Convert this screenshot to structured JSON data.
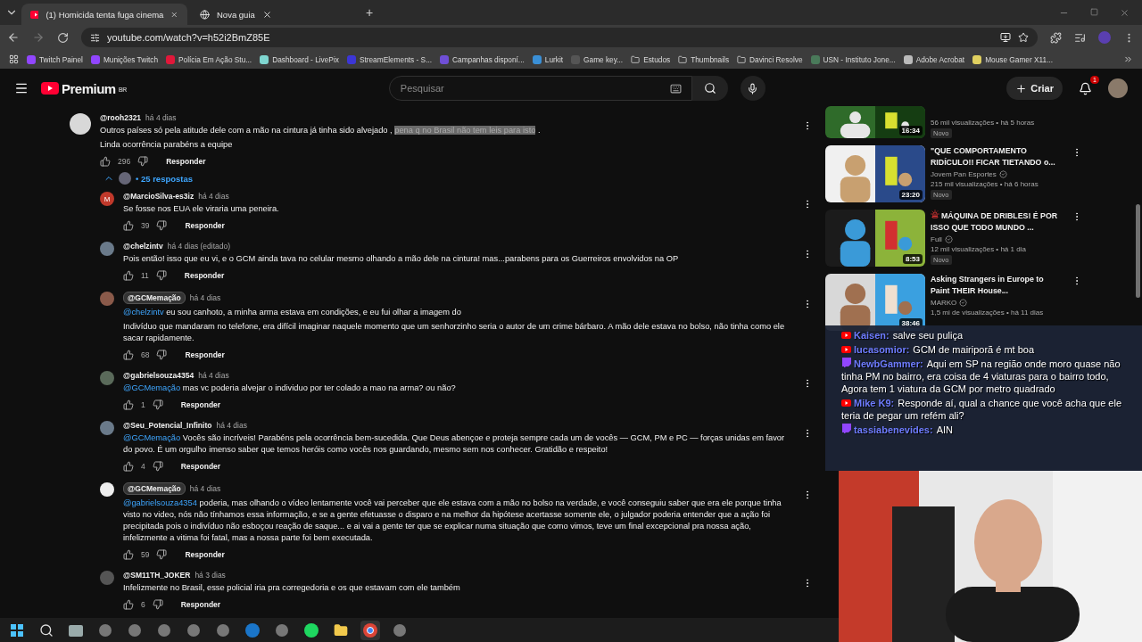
{
  "browser": {
    "tabs": [
      {
        "title": "(1) Homicida tenta fuga cinema",
        "selected": true,
        "kind": "youtube"
      },
      {
        "title": "Nova guia",
        "selected": false,
        "kind": "chrome"
      }
    ],
    "new_tab": "+",
    "url": "youtube.com/watch?v=h52i2BmZ85E",
    "bookmarks": [
      {
        "label": "Twitch Painel",
        "kind": "site",
        "color": "#9146ff"
      },
      {
        "label": "Munições Twitch",
        "kind": "site",
        "color": "#9146ff"
      },
      {
        "label": "Polícia Em Ação Stu...",
        "kind": "site",
        "color": "#e0183a"
      },
      {
        "label": "Dashboard - LivePix",
        "kind": "site",
        "color": "#7fd6d0"
      },
      {
        "label": "StreamElements - S...",
        "kind": "site",
        "color": "#3c36d6"
      },
      {
        "label": "Campanhas disponí...",
        "kind": "site",
        "color": "#6f4fd6"
      },
      {
        "label": "Lurkit",
        "kind": "site",
        "color": "#3a8fd6"
      },
      {
        "label": "Game key...",
        "kind": "site",
        "color": "#555555"
      },
      {
        "label": "Estudos",
        "kind": "folder"
      },
      {
        "label": "Thumbnails",
        "kind": "folder"
      },
      {
        "label": "Davinci Resolve",
        "kind": "folder"
      },
      {
        "label": "USN - Instituto Jone...",
        "kind": "site",
        "color": "#4a7a5a"
      },
      {
        "label": "Adobe Acrobat",
        "kind": "site",
        "color": "#bbbbbb"
      },
      {
        "label": "Mouse Gamer X11...",
        "kind": "site",
        "color": "#e0d060"
      }
    ]
  },
  "header": {
    "logo": "Premium",
    "region": "BR",
    "search": {
      "placeholder": "Pesquisar"
    },
    "create": "Criar",
    "notifications": "1"
  },
  "comment": {
    "author": "@rooh2321",
    "time": "há 4 dias",
    "paragraphs": [
      [
        {
          "text": "Outros países só pela atitude dele com a mão na cintura já tinha sido alvejado , ",
          "kind": "plain"
        },
        {
          "text": "pena q no Brasil não tem leis para isto",
          "kind": "selection"
        },
        {
          "text": " .",
          "kind": "plain"
        }
      ],
      [
        {
          "text": "Linda ocorrência parabéns a equipe",
          "kind": "plain"
        }
      ]
    ],
    "likes": "296",
    "reply": "Responder",
    "replies_toggle": {
      "label": "• 25 respostas",
      "expanded": true
    }
  },
  "replies": [
    {
      "author": "@MarcioSilva-es3iz",
      "owner": false,
      "time": "há 4 dias",
      "letter": "M",
      "paragraphs": [
        [
          {
            "text": "Se fosse nos EUA ele viraria uma peneira.",
            "kind": "plain"
          }
        ]
      ],
      "likes": "39",
      "reply": "Responder"
    },
    {
      "author": "@chelzintv",
      "owner": false,
      "time": "há 4 dias (editado)",
      "paragraphs": [
        [
          {
            "text": "Pois então! isso que eu vi, e o GCM ainda tava no celular mesmo olhando a mão dele na cintura! mas...parabens para os Guerreiros envolvidos na OP",
            "kind": "plain"
          }
        ]
      ],
      "likes": "11",
      "reply": "Responder"
    },
    {
      "author": "@GCMemação",
      "owner": true,
      "time": "há 4 dias",
      "paragraphs": [
        [
          {
            "text": "@chelzintv",
            "kind": "mention"
          },
          {
            "text": " eu sou canhoto, a minha arma estava em condições, e eu fui olhar a imagem do",
            "kind": "plain"
          }
        ],
        [
          {
            "text": "Indivíduo que mandaram no telefone, era difícil imaginar naquele momento que um senhorzinho seria o autor de um crime bárbaro. A mão dele estava no bolso, não tinha como ele sacar rapidamente.",
            "kind": "plain"
          }
        ]
      ],
      "likes": "68",
      "reply": "Responder"
    },
    {
      "author": "@gabrielsouza4354",
      "owner": false,
      "time": "há 4 dias",
      "paragraphs": [
        [
          {
            "text": "@GCMemação",
            "kind": "mention"
          },
          {
            "text": "  mas vc poderia alvejar o individuo por ter colado a mao na arma? ou não?",
            "kind": "plain"
          }
        ]
      ],
      "likes": "1",
      "reply": "Responder"
    },
    {
      "author": "@Seu_Potencial_Infinito",
      "owner": false,
      "time": "há 4 dias",
      "paragraphs": [
        [
          {
            "text": "@GCMemação",
            "kind": "mention"
          },
          {
            "text": "  Vocês são incríveis! Parabéns pela ocorrência bem-sucedida. Que Deus abençoe e proteja sempre cada um de vocês — GCM, PM e PC — forças unidas em favor do povo. É um orgulho imenso saber que temos heróis como vocês nos guardando, mesmo sem nos conhecer. Gratidão e respeito!",
            "kind": "plain"
          }
        ]
      ],
      "likes": "4",
      "reply": "Responder"
    },
    {
      "author": "@GCMemação",
      "owner": true,
      "time": "há 4 dias",
      "paragraphs": [
        [
          {
            "text": "@gabrielsouza4354",
            "kind": "mention"
          },
          {
            "text": " poderia, mas olhando o vídeo lentamente você vai perceber que ele estava com a mão no bolso na verdade, e você conseguiu saber que era ele porque tinha visto no video, nós não tínhamos essa informação, e se a gente efetuasse o disparo e na melhor da hipótese acertasse somente ele, o julgador poderia entender que a ação foi precipitada pois o indivíduo não esboçou reação de saque... e ai vai a gente ter que se explicar numa situação que como vimos, teve um final excepcional pra nossa ação, infelizmente a vitima foi fatal, mas a nossa parte foi bem executada.",
            "kind": "plain"
          }
        ]
      ],
      "likes": "59",
      "reply": "Responder"
    },
    {
      "author": "@SM11TH_JOKER",
      "owner": false,
      "time": "há 3 dias",
      "paragraphs": [
        [
          {
            "text": "Infelizmente no Brasil, esse policial iria pra corregedoria e os que estavam com ele também",
            "kind": "plain"
          }
        ]
      ],
      "likes": "6",
      "reply": "Responder"
    }
  ],
  "sidebar": [
    {
      "stats": "56 mil visualizações • há 5 horas",
      "badge": "Novo",
      "duration": "16:34"
    },
    {
      "title": "\"QUE COMPORTAMENTO RIDÍCULO!! FICAR TIETANDO o...",
      "channel": "Jovem Pan Esportes",
      "verified": true,
      "stats": "215 mil visualizações • há 6 horas",
      "badge": "Novo",
      "duration": "23:20"
    },
    {
      "title": "MÁQUINA DE DRIBLES! É POR ISSO QUE TODO MUNDO ...",
      "channel": "Full",
      "verified": true,
      "stats": "12 mil visualizações • há 1 dia",
      "badge": "Novo",
      "duration": "8:53",
      "siren": true
    },
    {
      "title": "Asking Strangers in Europe to Paint THEIR House...",
      "channel": "MARKO",
      "verified": true,
      "stats": "1,5 mi de visualizações • há 11 dias",
      "duration": "38:46"
    }
  ],
  "stream_chat": [
    {
      "kind": "youtube",
      "user": "Kaisen:",
      "text": "salve seu puliça"
    },
    {
      "kind": "youtube",
      "user": "lucasomior:",
      "text": "GCM de mairiporã é mt boa"
    },
    {
      "kind": "twitch",
      "user": "NewbGammer:",
      "text": "Aqui em SP na região onde moro quase não tinha PM no bairro, era coisa de 4 viaturas para o bairro todo, Agora tem 1 viatura da GCM por metro quadrado"
    },
    {
      "kind": "youtube",
      "user": "Mike K9:",
      "text": "Responde aí, qual a chance que você acha que ele teria de pegar um refém ali?"
    },
    {
      "kind": "twitch",
      "user": "tassiabenevides:",
      "text": "AIN"
    }
  ],
  "taskbar": [
    {
      "kind": "start"
    },
    {
      "kind": "search"
    },
    {
      "kind": "files"
    },
    {
      "kind": "app"
    },
    {
      "kind": "app"
    },
    {
      "kind": "app"
    },
    {
      "kind": "app"
    },
    {
      "kind": "app"
    },
    {
      "kind": "steam"
    },
    {
      "kind": "app"
    },
    {
      "kind": "spotify"
    },
    {
      "kind": "folder"
    },
    {
      "kind": "chrome"
    },
    {
      "kind": "app"
    }
  ]
}
